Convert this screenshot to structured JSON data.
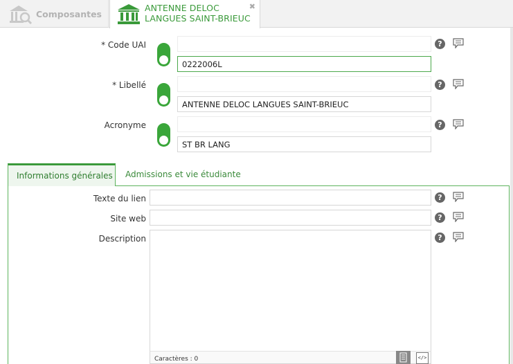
{
  "tabs": {
    "inactive_label": "Composantes",
    "active_line1": "ANTENNE DELOC",
    "active_line2": "LANGUES SAINT-BRIEUC",
    "close_glyph": "✖"
  },
  "fields": {
    "code_uai": {
      "label": "* Code UAI",
      "value": "0222006L"
    },
    "libelle": {
      "label": "* Libellé",
      "value": "ANTENNE DELOC LANGUES SAINT-BRIEUC"
    },
    "acronyme": {
      "label": "Acronyme",
      "value": "ST BR LANG"
    }
  },
  "section_tabs": {
    "general": "Informations générales",
    "admissions": "Admissions et vie étudiante"
  },
  "general": {
    "texte_lien_label": "Texte du lien",
    "texte_lien_value": "",
    "site_web_label": "Site web",
    "site_web_value": "",
    "description_label": "Description",
    "char_count": "Caractères : 0",
    "source_btn": "</>"
  },
  "help_glyph": "?",
  "colors": {
    "accent": "#3aa63a",
    "tab_text": "#3a9a3a"
  }
}
